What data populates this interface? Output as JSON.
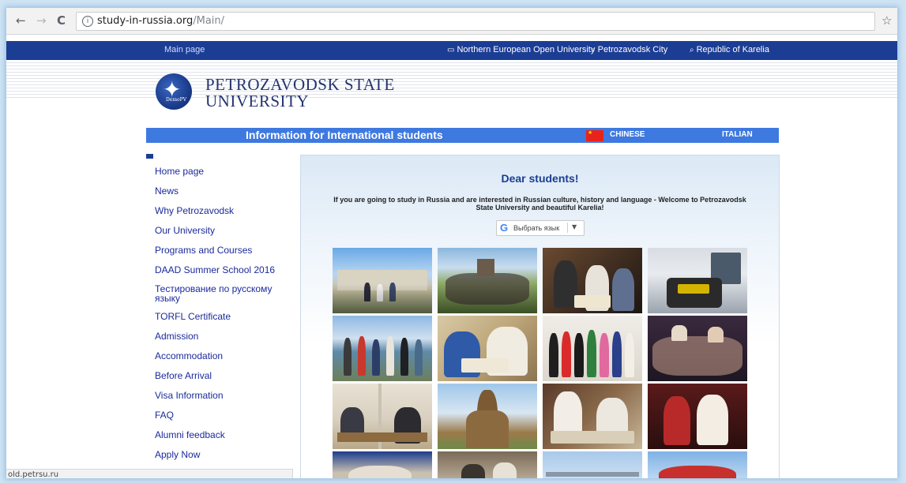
{
  "browser": {
    "back_icon": "←",
    "forward_icon": "→",
    "reload_icon": "C",
    "info_icon": "i",
    "url_domain": "study-in-russia.org",
    "url_path": "/Main/",
    "bookmark_icon": "☆",
    "status_text": "old.petrsu.ru"
  },
  "topnav": {
    "home": "Main page",
    "links": [
      {
        "icon": "book-icon",
        "glyph": "▭",
        "label": "Northern European Open University"
      },
      {
        "icon": "search-icon",
        "glyph": "⌕",
        "label": "Petrozavodsk City"
      },
      {
        "icon": "search-icon",
        "glyph": "⌕",
        "label": "Republic of Karelia"
      }
    ]
  },
  "header": {
    "logo_glyph": "✦",
    "logo_text": "DemoPV",
    "name_line1": "PETROZAVODSK STATE",
    "name_line2": "UNIVERSITY"
  },
  "infobar": {
    "title": "Information for International students",
    "lang_chinese": "CHINESE",
    "lang_italian": "ITALIAN"
  },
  "sidebar": {
    "items": [
      "Home page",
      "News",
      "Why Petrozavodsk",
      "Our University",
      "Programs and Courses",
      "DAAD Summer School 2016",
      "Тестирование по русскому языку",
      "TORFL Certificate",
      "Admission",
      "Accommodation",
      "Before Arrival",
      "Visa Information",
      "FAQ",
      "Alumni feedback",
      "Apply Now"
    ]
  },
  "main": {
    "title": "Dear students!",
    "intro": "If you are going to study in Russia and are interested in Russian culture, history and language - Welcome to Petrozavodsk State University and beautiful  Karelia!",
    "translate_g": "G",
    "translate_label": "Выбрать язык",
    "translate_arrow": "▼"
  },
  "colors": {
    "nav_blue": "#1c3d94",
    "infobar_blue": "#3e79e0",
    "link_blue": "#1b2a9c"
  }
}
